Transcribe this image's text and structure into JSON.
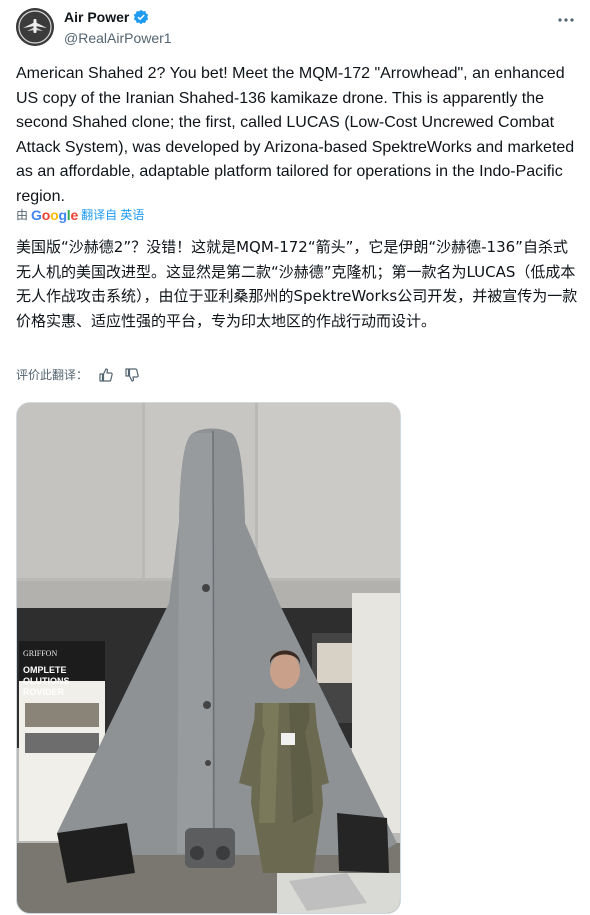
{
  "account": {
    "display_name": "Air Power",
    "handle": "@RealAirPower1",
    "avatar_icon": "air-power-logo-icon",
    "verified_color": "#1d9bf0"
  },
  "tweet": {
    "text": "American Shahed 2? You bet! Meet the MQM-172 \"Arrowhead\", an enhanced US copy of the Iranian Shahed-136 kamikaze drone. This is apparently the second Shahed clone; the first, called LUCAS (Low-Cost Uncrewed Combat Attack System), was developed by Arizona-based SpektreWorks and marketed as an affordable, adaptable platform tailored for operations in the Indo-Pacific region."
  },
  "translation": {
    "by_label": "由",
    "google_label": "Google",
    "translate_from": "翻译自 英语",
    "text": "美国版“沙赫德2”？没错！这就是MQM-172“箭头”，它是伊朗“沙赫德-136”自杀式无人机的美国改进型。这显然是第二款“沙赫德”克隆机；第一款名为LUCAS（低成本无人作战攻击系统），由位于亚利桑那州的SpektreWorks公司开发，并被宣传为一款价格实惠、适应性强的平台，专为印太地区的作战行动而设计。",
    "rate_label": "评价此翻译："
  },
  "media": {
    "banner_lines": [
      "OMPLETE",
      "OLUTIONS",
      "ROVIDER"
    ],
    "banner_brand": "GRIFFON"
  },
  "colors": {
    "text": "#0f1419",
    "muted": "#536471",
    "link": "#1d9bf0"
  }
}
